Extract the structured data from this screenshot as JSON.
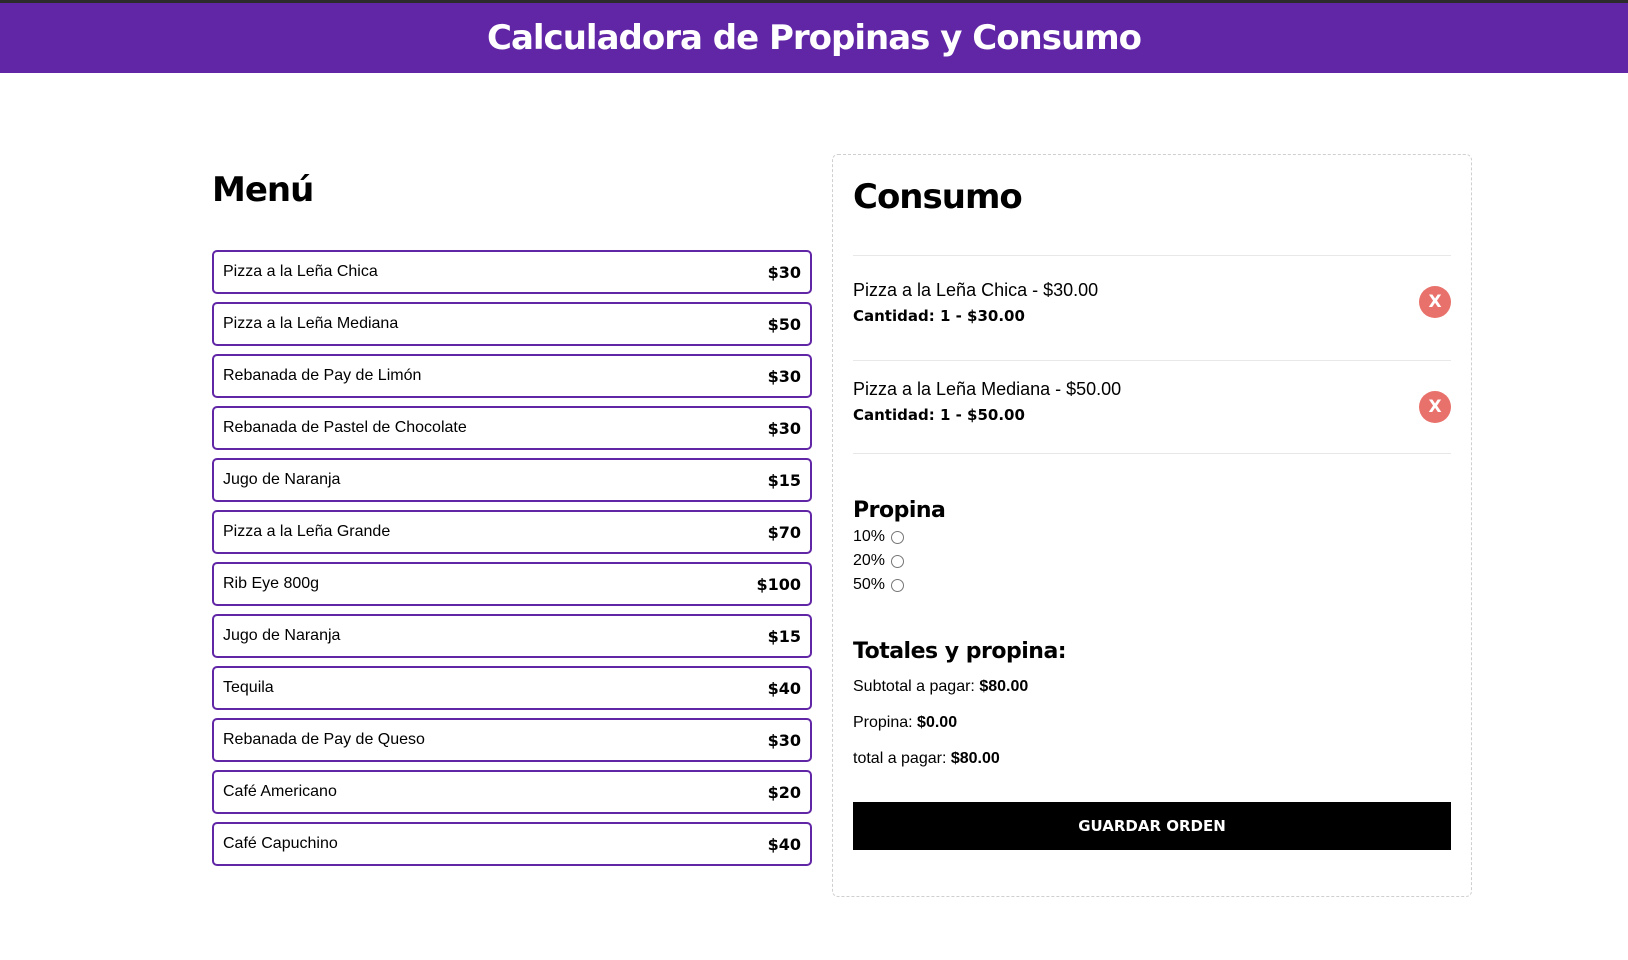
{
  "header": {
    "title": "Calculadora de Propinas y Consumo"
  },
  "menu": {
    "title": "Menú",
    "items": [
      {
        "name": "Pizza a la Leña Chica",
        "price": "$30"
      },
      {
        "name": "Pizza a la Leña Mediana",
        "price": "$50"
      },
      {
        "name": "Rebanada de Pay de Limón",
        "price": "$30"
      },
      {
        "name": "Rebanada de Pastel de Chocolate",
        "price": "$30"
      },
      {
        "name": "Jugo de Naranja",
        "price": "$15"
      },
      {
        "name": "Pizza a la Leña Grande",
        "price": "$70"
      },
      {
        "name": "Rib Eye 800g",
        "price": "$100"
      },
      {
        "name": "Jugo de Naranja",
        "price": "$15"
      },
      {
        "name": "Tequila",
        "price": "$40"
      },
      {
        "name": "Rebanada de Pay de Queso",
        "price": "$30"
      },
      {
        "name": "Café Americano",
        "price": "$20"
      },
      {
        "name": "Café Capuchino",
        "price": "$40"
      }
    ]
  },
  "consumo": {
    "title": "Consumo",
    "orders": [
      {
        "name": "Pizza a la Leña Chica - $30.00",
        "qty": "Cantidad: 1 - $30.00",
        "remove_label": "X"
      },
      {
        "name": "Pizza a la Leña Mediana - $50.00",
        "qty": "Cantidad: 1 - $50.00",
        "remove_label": "X"
      }
    ],
    "propina": {
      "title": "Propina",
      "options": [
        {
          "label": "10%",
          "checked": false
        },
        {
          "label": "20%",
          "checked": false
        },
        {
          "label": "50%",
          "checked": false
        }
      ]
    },
    "totales": {
      "title": "Totales y propina:",
      "subtotal_label": "Subtotal a pagar:",
      "subtotal_value": "$80.00",
      "propina_label": "Propina:",
      "propina_value": "$0.00",
      "total_label": "total a pagar:",
      "total_value": "$80.00"
    },
    "save_label": "GUARDAR ORDEN"
  },
  "colors": {
    "brand": "#6126a6",
    "remove": "#e9716b",
    "button": "#000000"
  }
}
